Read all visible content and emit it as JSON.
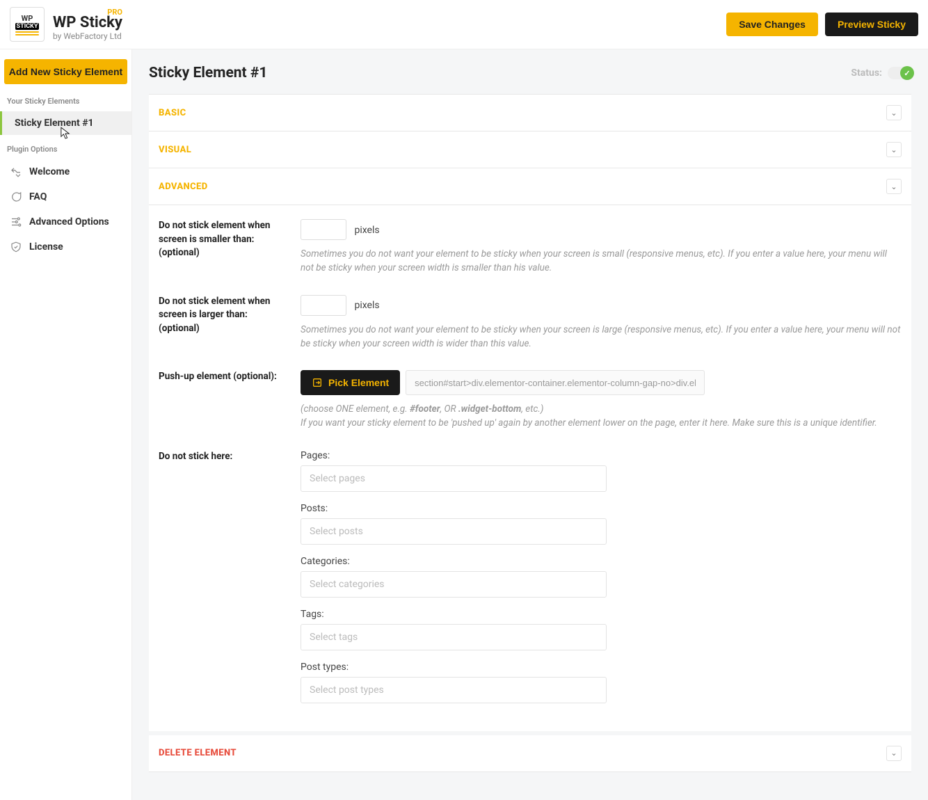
{
  "header": {
    "pro_badge": "PRO",
    "app_name": "WP Sticky",
    "by_line": "by WebFactory Ltd",
    "save_label": "Save Changes",
    "preview_label": "Preview Sticky"
  },
  "sidebar": {
    "add_button": "Add New Sticky Element",
    "section_elements": "Your Sticky Elements",
    "element_items": [
      "Sticky Element #1"
    ],
    "section_options": "Plugin Options",
    "option_items": [
      {
        "icon": "welcome",
        "label": "Welcome"
      },
      {
        "icon": "faq",
        "label": "FAQ"
      },
      {
        "icon": "advanced",
        "label": "Advanced Options"
      },
      {
        "icon": "license",
        "label": "License"
      }
    ]
  },
  "page": {
    "title": "Sticky Element #1",
    "status_label": "Status:"
  },
  "panels": {
    "basic": "BASIC",
    "visual": "VISUAL",
    "advanced": "ADVANCED",
    "delete": "DELETE ELEMENT"
  },
  "advanced": {
    "min_screen": {
      "label": "Do not stick element when screen is smaller than: (optional)",
      "unit": "pixels",
      "value": "",
      "desc": "Sometimes you do not want your element to be sticky when your screen is small (responsive menus, etc). If you enter a value here, your menu will not be sticky when your screen width is smaller than his value."
    },
    "max_screen": {
      "label": "Do not stick element when screen is larger than: (optional)",
      "unit": "pixels",
      "value": "",
      "desc": "Sometimes you do not want your element to be sticky when your screen is large (responsive menus, etc). If you enter a value here, your menu will not be sticky when your screen width is wider than this value."
    },
    "pushup": {
      "label": "Push-up element (optional):",
      "pick_btn": "Pick Element",
      "value": "section#start>div.elementor-container.elementor-column-gap-no>div.elementor-ro",
      "desc1_prefix": "(choose ONE element, e.g. ",
      "desc1_em1": "#footer",
      "desc1_mid": ", OR ",
      "desc1_em2": ".widget-bottom",
      "desc1_suffix": ", etc.)",
      "desc2": "If you want your sticky element to be 'pushed up' again by another element lower on the page, enter it here. Make sure this is a unique identifier."
    },
    "dont_stick": {
      "label": "Do not stick here:",
      "groups": [
        {
          "label": "Pages:",
          "placeholder": "Select pages"
        },
        {
          "label": "Posts:",
          "placeholder": "Select posts"
        },
        {
          "label": "Categories:",
          "placeholder": "Select categories"
        },
        {
          "label": "Tags:",
          "placeholder": "Select tags"
        },
        {
          "label": "Post types:",
          "placeholder": "Select post types"
        }
      ]
    }
  },
  "colors": {
    "accent": "#f5b400",
    "green": "#6cc24a",
    "red": "#e74c3c"
  }
}
